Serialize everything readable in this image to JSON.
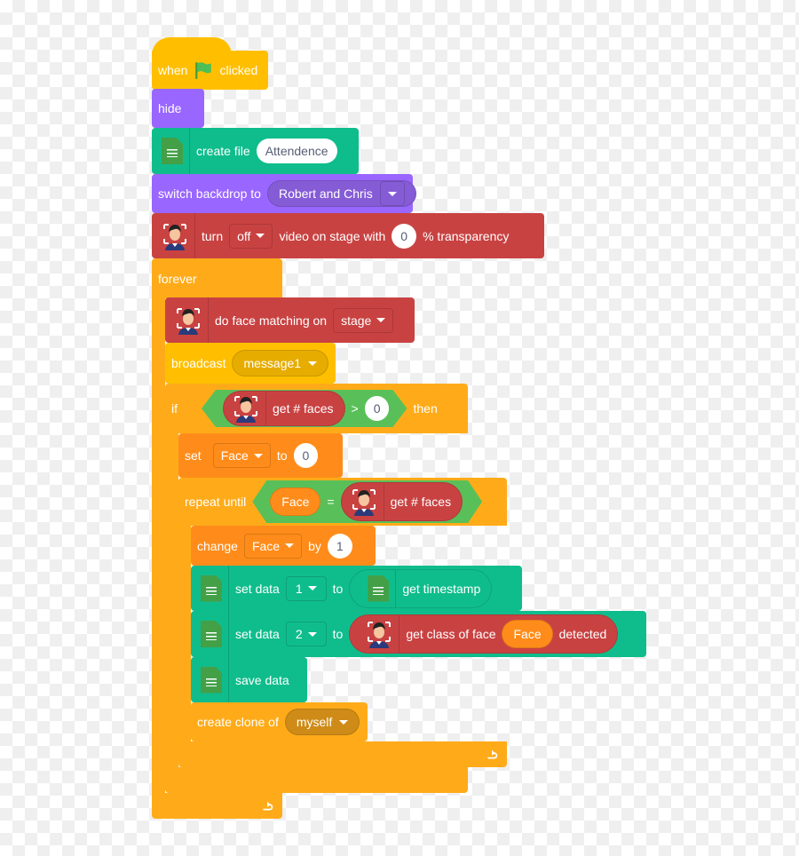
{
  "blocks": {
    "when": {
      "pre": "when",
      "post": "clicked"
    },
    "hide": {
      "label": "hide"
    },
    "create_file": {
      "label": "create file",
      "value": "Attendence"
    },
    "switch_backdrop": {
      "label": "switch backdrop to",
      "value": "Robert and Chris"
    },
    "video": {
      "turn": "turn",
      "state": "off",
      "mid": "video on stage with",
      "value": "0",
      "post": "% transparency"
    },
    "forever": {
      "label": "forever"
    },
    "face_match": {
      "label": "do face matching on",
      "value": "stage"
    },
    "broadcast": {
      "label": "broadcast",
      "value": "message1"
    },
    "if": {
      "label": "if",
      "reporter": "get # faces",
      "op": ">",
      "value": "0",
      "then": "then"
    },
    "set": {
      "label": "set",
      "var": "Face",
      "to": "to",
      "value": "0"
    },
    "repeat": {
      "label": "repeat until",
      "var": "Face",
      "op": "=",
      "reporter": "get # faces"
    },
    "change": {
      "label": "change",
      "var": "Face",
      "by": "by",
      "value": "1"
    },
    "set_data1": {
      "label": "set  data",
      "slot": "1",
      "to": "to",
      "reporter": "get timestamp"
    },
    "set_data2": {
      "label": "set  data",
      "slot": "2",
      "to": "to",
      "reporter_pre": "get class of face",
      "var": "Face",
      "reporter_post": "detected"
    },
    "save_data": {
      "label": "save data"
    },
    "clone": {
      "label": "create clone of",
      "value": "myself"
    }
  },
  "colors": {
    "events": "#ffbf00",
    "looks": "#9966ff",
    "sheets": "#0fbd8c",
    "face": "#c94242",
    "control": "#ffab19",
    "variables": "#ff8c1a",
    "operators": "#59c059"
  }
}
